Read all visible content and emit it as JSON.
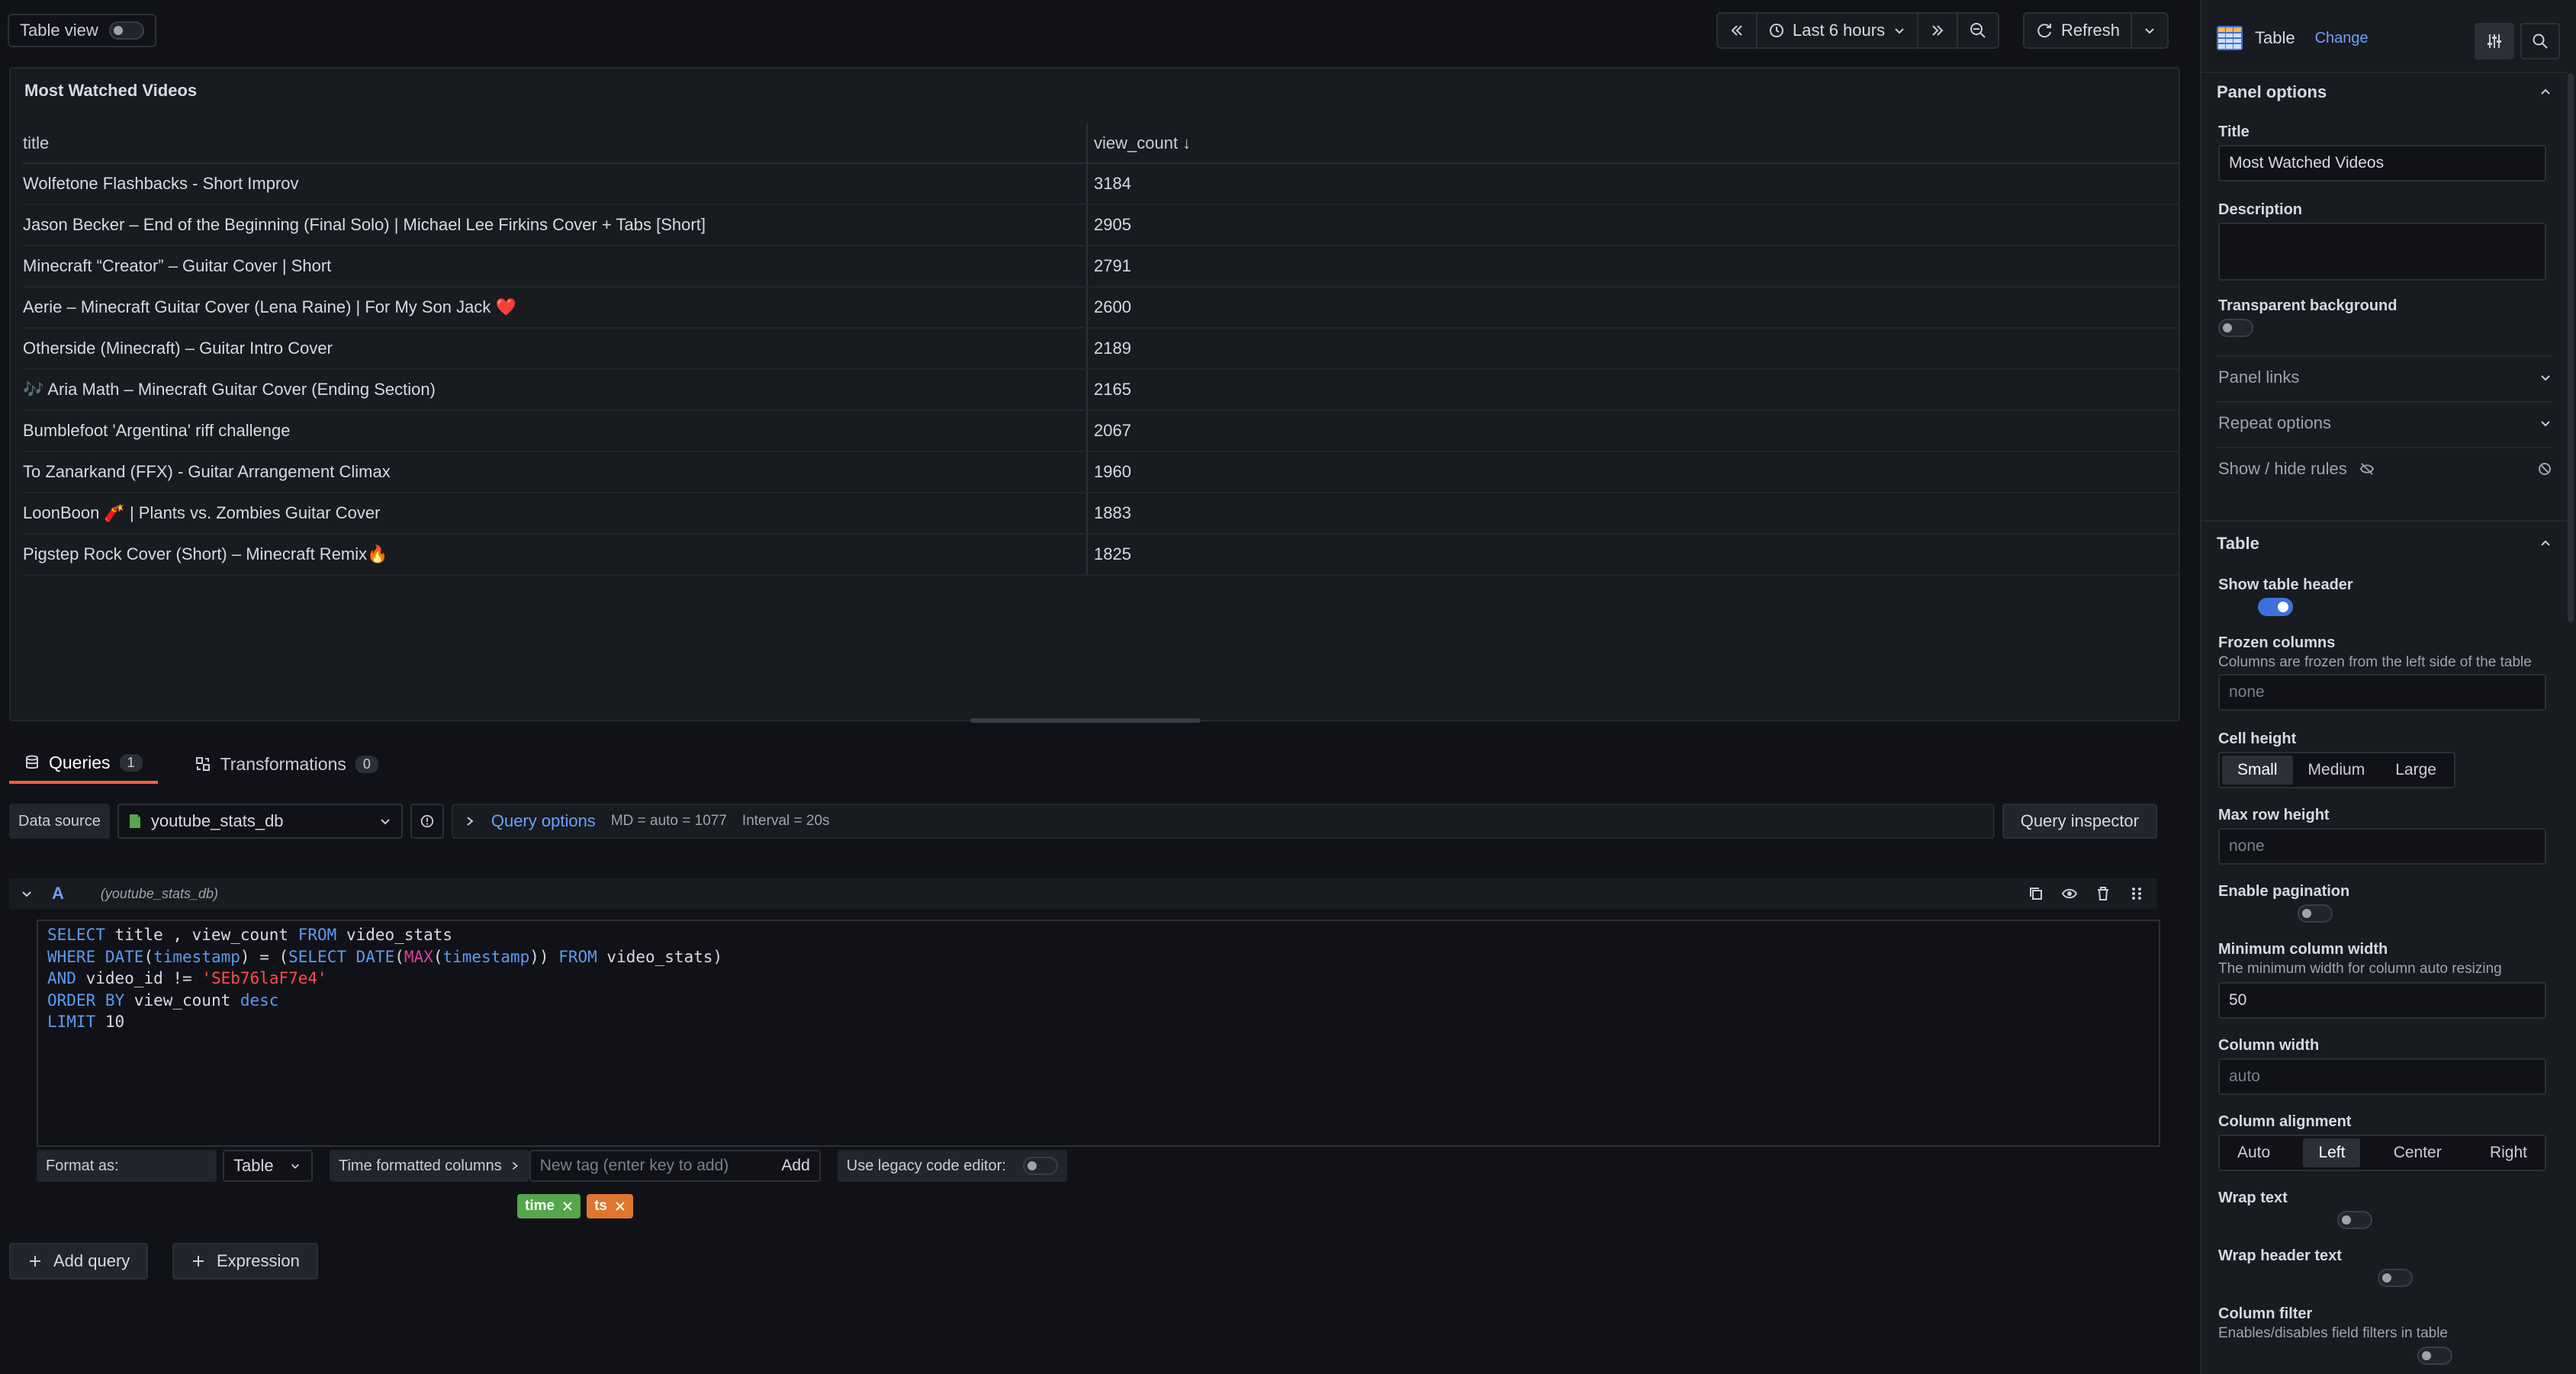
{
  "topbar": {
    "table_view_label": "Table view",
    "time_range": "Last 6 hours",
    "refresh_label": "Refresh"
  },
  "panel": {
    "title": "Most Watched Videos",
    "columns": [
      "title",
      "view_count ↓"
    ],
    "rows": [
      {
        "title": "Wolfetone Flashbacks - Short Improv",
        "view_count": "3184"
      },
      {
        "title": "Jason Becker – End of the Beginning (Final Solo) | Michael Lee Firkins Cover + Tabs [Short]",
        "view_count": "2905"
      },
      {
        "title": "Minecraft “Creator” – Guitar Cover | Short",
        "view_count": "2791"
      },
      {
        "title": "Aerie – Minecraft Guitar Cover (Lena Raine) | For My Son Jack ❤️",
        "view_count": "2600"
      },
      {
        "title": "Otherside (Minecraft) – Guitar Intro Cover",
        "view_count": "2189"
      },
      {
        "title": "🎶 Aria Math – Minecraft Guitar Cover (Ending Section)",
        "view_count": "2165"
      },
      {
        "title": "Bumblefoot 'Argentina' riff challenge",
        "view_count": "2067"
      },
      {
        "title": "To Zanarkand (FFX) - Guitar Arrangement Climax",
        "view_count": "1960"
      },
      {
        "title": "LoonBoon 🧨 | Plants vs. Zombies Guitar Cover",
        "view_count": "1883"
      },
      {
        "title": "Pigstep Rock Cover (Short) – Minecraft Remix🔥",
        "view_count": "1825"
      }
    ]
  },
  "tabs": {
    "queries_label": "Queries",
    "queries_count": "1",
    "transformations_label": "Transformations",
    "transformations_count": "0"
  },
  "query_options": {
    "data_source_label": "Data source",
    "data_source_value": "youtube_stats_db",
    "options_label": "Query options",
    "md": "MD = auto = 1077",
    "interval": "Interval = 20s",
    "inspector_label": "Query inspector"
  },
  "query": {
    "ref_id": "A",
    "source_hint": "(youtube_stats_db)",
    "format_label": "Format as:",
    "format_value": "Table",
    "time_cols_label": "Time formatted columns",
    "tag_placeholder": "New tag (enter key to add)",
    "add_label": "Add",
    "legacy_label": "Use legacy code editor:",
    "tags": [
      "time",
      "ts"
    ],
    "add_query_label": "Add query",
    "expression_label": "Expression"
  },
  "sidebar": {
    "viz_name": "Table",
    "change_label": "Change",
    "panel_options_header": "Panel options",
    "title_label": "Title",
    "title_value": "Most Watched Videos",
    "description_label": "Description",
    "transparent_label": "Transparent background",
    "panel_links_label": "Panel links",
    "repeat_options_label": "Repeat options",
    "show_hide_label": "Show / hide rules",
    "table_header": "Table",
    "show_header_label": "Show table header",
    "frozen_label": "Frozen columns",
    "frozen_desc": "Columns are frozen from the left side of the table",
    "frozen_placeholder": "none",
    "cell_height_label": "Cell height",
    "cell_height_options": [
      "Small",
      "Medium",
      "Large"
    ],
    "max_row_label": "Max row height",
    "max_row_placeholder": "none",
    "pagination_label": "Enable pagination",
    "min_width_label": "Minimum column width",
    "min_width_desc": "The minimum width for column auto resizing",
    "min_width_value": "50",
    "col_width_label": "Column width",
    "col_width_placeholder": "auto",
    "alignment_label": "Column alignment",
    "alignment_options": [
      "Auto",
      "Left",
      "Center",
      "Right"
    ],
    "wrap_text_label": "Wrap text",
    "wrap_header_label": "Wrap header text",
    "col_filter_label": "Column filter",
    "col_filter_desc": "Enables/disables field filters in table"
  },
  "colors": {
    "accent": "#3d71d9",
    "tab_active": "#f55f3e",
    "tag_time": "#56a64b",
    "tag_ts": "#e0752d"
  }
}
